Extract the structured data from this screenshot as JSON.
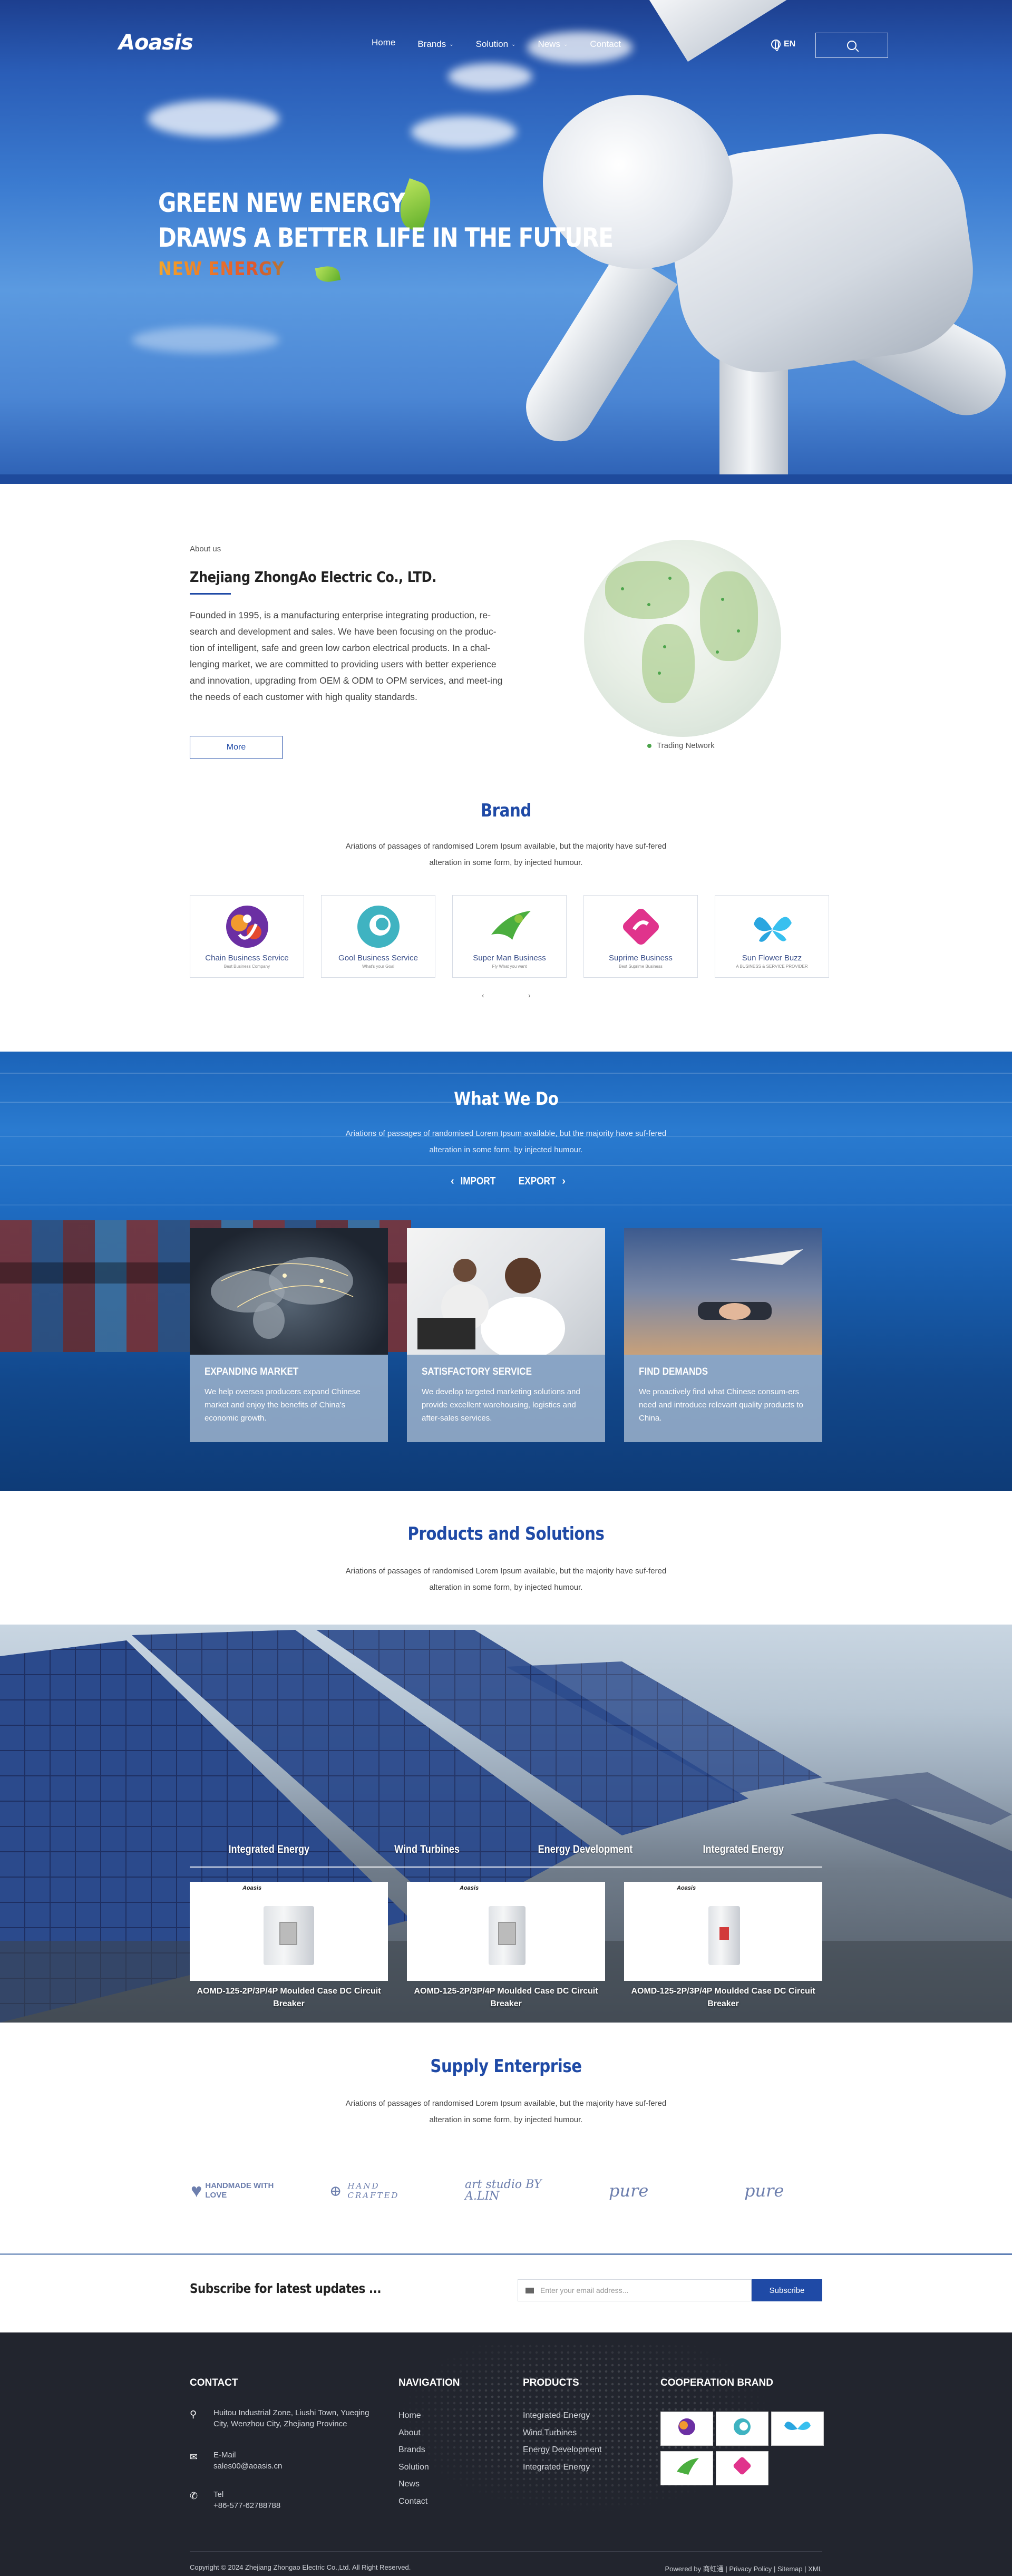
{
  "brand_logo": "Aoasis",
  "nav": {
    "items": [
      {
        "label": "Home"
      },
      {
        "label": "Brands"
      },
      {
        "label": "Solution"
      },
      {
        "label": "News"
      },
      {
        "label": "Contact"
      }
    ],
    "lang": "EN"
  },
  "hero": {
    "line1": "GREEN NEW ENERGY",
    "line2": "DRAWS A BETTER LIFE IN THE FUTURE",
    "sub": "NEW ENERGY"
  },
  "about": {
    "tag": "About us",
    "company": "Zhejiang ZhongAo Electric Co., LTD.",
    "desc": "Founded in 1995, is a manufacturing enterprise integrating production, re-search and development and sales. We have been focusing on the produc-tion of intelligent, safe and green low carbon electrical products. In a chal-lenging market, we are committed to providing users with better experience and innovation, upgrading from OEM & ODM to OPM services, and meet-ing the needs of each customer with high quality standards.",
    "more": "More",
    "trading": "Trading Network"
  },
  "brand": {
    "title": "Brand",
    "desc": "Ariations of passages of randomised Lorem Ipsum available, but the majority have suf-fered alteration in some form, by injected humour.",
    "cards": [
      {
        "name": "Chain Business Service",
        "sub": "Best Business Company",
        "color": "#e4492e"
      },
      {
        "name": "Gool Business Service",
        "sub": "What's your Goal",
        "color": "#3fb3c1"
      },
      {
        "name": "Super Man Business",
        "sub": "Fly What you want",
        "color": "#4bae3f"
      },
      {
        "name": "Suprime Business",
        "sub": "Best Suprime Business",
        "color": "#e0338c"
      },
      {
        "name": "Sun Flower Buzz",
        "sub": "A BUSINESS & SERVICE PROVIDER",
        "color": "#2aa6e0"
      }
    ],
    "prev": "‹",
    "next": "›"
  },
  "wwd": {
    "title": "What We Do",
    "desc": "Ariations of passages of randomised Lorem Ipsum available, but the majority have suf-fered alteration in some form, by injected humour.",
    "import": "IMPORT",
    "export": "EXPORT",
    "cards": [
      {
        "title": "EXPANDING MARKET",
        "text": "We help oversea producers expand Chinese market and enjoy the benefits of China's economic growth."
      },
      {
        "title": "SATISFACTORY SERVICE",
        "text": "We develop targeted marketing solutions and provide excellent warehousing, logistics and after-sales services."
      },
      {
        "title": "FIND DEMANDS",
        "text": "We proactively find what Chinese consum-ers need and introduce relevant quality products to China."
      }
    ]
  },
  "products": {
    "title": "Products and Solutions",
    "desc": "Ariations of passages of randomised Lorem Ipsum available, but the majority have suf-fered alteration in some form, by injected humour.",
    "tabs": [
      "Integrated Energy",
      "Wind Turbines",
      "Energy Development",
      "Integrated Energy"
    ],
    "cards": [
      {
        "logo": "Aoasis",
        "name": "AOMD-125-2P/3P/4P Moulded Case DC Circuit Breaker"
      },
      {
        "logo": "Aoasis",
        "name": "AOMD-125-2P/3P/4P Moulded Case DC Circuit Breaker"
      },
      {
        "logo": "Aoasis",
        "name": "AOMD-125-2P/3P/4P Moulded Case DC Circuit Breaker"
      }
    ]
  },
  "supply": {
    "title": "Supply Enterprise",
    "desc": "Ariations of passages of randomised Lorem Ipsum available, but the majority have suf-fered alteration in some form, by injected humour.",
    "logos": [
      "HANDMADE WITH LOVE",
      "HAND CRAFTED",
      "art studio BY A.LIN",
      "pure",
      "pure"
    ]
  },
  "subscribe": {
    "label": "Subscribe for latest updates ...",
    "placeholder": "Enter your email address...",
    "button": "Subscribe"
  },
  "footer": {
    "contact_title": "CONTACT",
    "address": "Huitou Industrial Zone, Liushi Town, Yueqing City, Wenzhou City, Zhejiang Province",
    "email_label": "E-Mail",
    "email": "sales00@aoasis.cn",
    "tel_label": "Tel",
    "tel": "+86-577-62788788",
    "nav_title": "NAVIGATION",
    "nav": [
      "Home",
      "About",
      "Brands",
      "Solution",
      "News",
      "Contact"
    ],
    "prod_title": "PRODUCTS",
    "products": [
      "Integrated Energy",
      "Wind Turbines",
      "Energy Development",
      "Integrated Energy"
    ],
    "coop_title": "COOPERATION BRAND",
    "copyright": "Copyright © 2024 Zhejiang Zhongao Electric Co.,Ltd. All Right Reserved.",
    "powered_label": "Powered by",
    "powered_by": "商虹通",
    "links": [
      "Privacy Policy",
      "Sitemap",
      "XML"
    ]
  }
}
